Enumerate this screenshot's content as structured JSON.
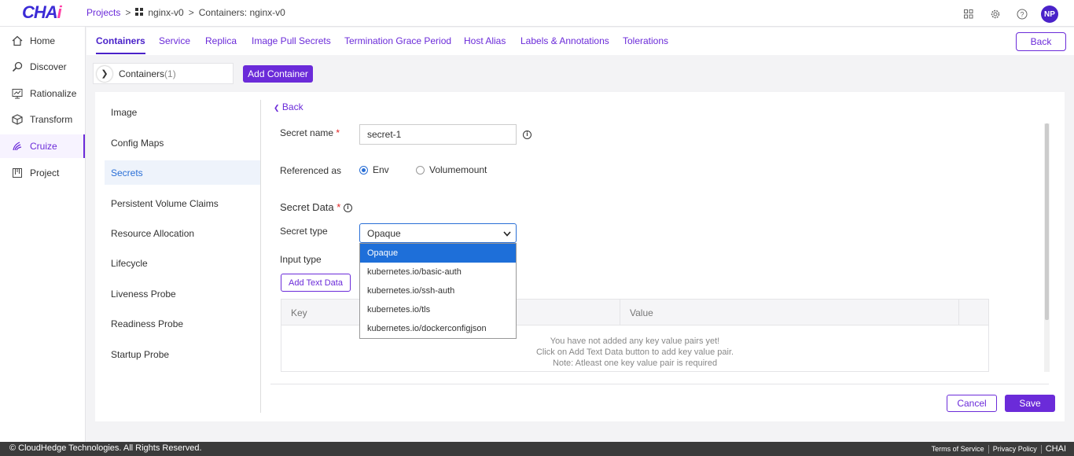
{
  "app": {
    "logo_main": "CHA",
    "logo_accent": "i"
  },
  "breadcrumb": {
    "projects": "Projects",
    "project": "nginx-v0",
    "current": "Containers: nginx-v0"
  },
  "user": {
    "initials": "NP"
  },
  "sidebar": {
    "items": [
      {
        "label": "Home",
        "icon": "home-icon"
      },
      {
        "label": "Discover",
        "icon": "discover-icon"
      },
      {
        "label": "Rationalize",
        "icon": "rationalize-icon"
      },
      {
        "label": "Transform",
        "icon": "transform-icon"
      },
      {
        "label": "Cruize",
        "icon": "cruize-icon",
        "active": true
      },
      {
        "label": "Project",
        "icon": "project-icon"
      }
    ]
  },
  "tabs": [
    "Containers",
    "Service",
    "Replica",
    "Image Pull Secrets",
    "Termination Grace Period",
    "Host Alias",
    "Labels & Annotations",
    "Tolerations"
  ],
  "back_button": "Back",
  "containers": {
    "label": "Containers",
    "count": "(1)",
    "add_label": "Add Container"
  },
  "left_menu": [
    "Image",
    "Config Maps",
    "Secrets",
    "Persistent Volume Claims",
    "Resource Allocation",
    "Lifecycle",
    "Liveness Probe",
    "Readiness Probe",
    "Startup Probe"
  ],
  "form": {
    "back_link": "Back",
    "secret_name_label": "Secret name",
    "required_mark": "*",
    "secret_name_value": "secret-1",
    "referenced_as_label": "Referenced as",
    "radio_env": "Env",
    "radio_volumemount": "Volumemount",
    "secret_data_title": "Secret Data",
    "secret_type_label": "Secret type",
    "secret_type_value": "Opaque",
    "secret_type_options": [
      "Opaque",
      "kubernetes.io/basic-auth",
      "kubernetes.io/ssh-auth",
      "kubernetes.io/tls",
      "kubernetes.io/dockerconfigjson"
    ],
    "input_type_label": "Input type",
    "add_text_data": "Add Text Data",
    "table_headers": [
      "Key",
      "Value"
    ],
    "empty_lines": [
      "You have not added any key value pairs yet!",
      "Click on Add Text Data button to add key value pair.",
      "Note: Atleast one key value pair is required"
    ],
    "cancel": "Cancel",
    "save": "Save"
  },
  "footer": {
    "copyright": "© CloudHedge Technologies. All Rights Reserved.",
    "terms": "Terms of Service",
    "privacy": "Privacy Policy",
    "brand": "CHAI"
  }
}
